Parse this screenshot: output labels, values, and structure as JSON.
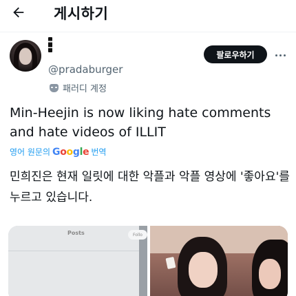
{
  "header": {
    "back_icon": "arrow-left-icon",
    "title": "게시하기"
  },
  "author": {
    "handle": "@pradaburger",
    "parody_label": "패러디 계정",
    "parody_icon": "mask-icon",
    "follow_label": "팔로우하기",
    "more_icon": "more-icon"
  },
  "tweet": {
    "text_en": "Min-Heejin is now liking hate comments and hate videos of ILLIT",
    "translate_prefix": "영어 원문의",
    "translate_google": [
      "G",
      "o",
      "o",
      "g",
      "l",
      "e"
    ],
    "translate_suffix": "번역",
    "text_ko": "민희진은 현재 일릿에 대한 악플과 악플 영상에 '좋아요'를 누르고 있습니다."
  },
  "media": {
    "left": {
      "title": "Posts",
      "button": "Follo"
    }
  },
  "colors": {
    "link": "#1d9bf0",
    "text": "#0f1419",
    "secondary": "#536471",
    "follow_bg": "#0f1419"
  }
}
